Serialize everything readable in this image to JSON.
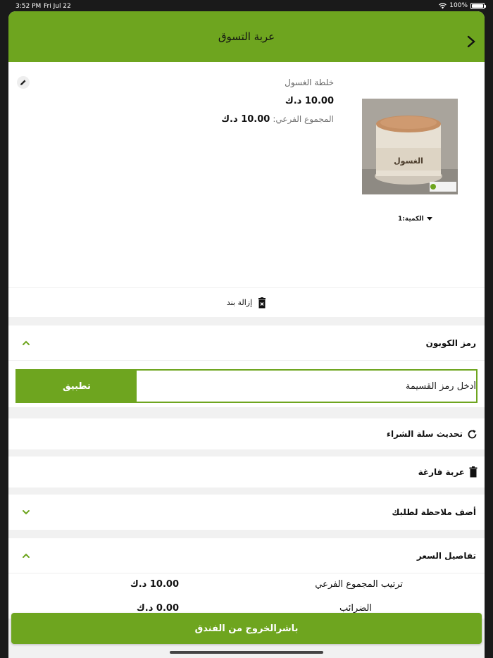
{
  "status_bar": {
    "time": "3:52 PM",
    "date": "Fri Jul 22",
    "battery": "100%"
  },
  "header": {
    "title": "عربة التسوق"
  },
  "product": {
    "name": "خلطة الغسول",
    "price": "10.00 د.ك",
    "subtotal_label": "المجموع الفرعي:",
    "subtotal_value": "10.00 د.ك",
    "quantity_label": "الكمية:1",
    "image_label": "الغسول"
  },
  "remove_item": {
    "label": "إزالة بند"
  },
  "coupon": {
    "title": "رمز الكوبون",
    "input_placeholder": "أدخل رمز القسيمة",
    "apply_label": "تطبيق"
  },
  "update_cart": {
    "label": "تحديث سلة الشراء"
  },
  "empty_cart": {
    "label": "عربة فارغة"
  },
  "add_note": {
    "label": "أضف ملاحظة لطلبك"
  },
  "price_details": {
    "title": "تفاصيل السعر",
    "lines": [
      {
        "label": "ترتيب المجموع الفرعي",
        "value": "10.00 د.ك"
      },
      {
        "label": "الضرائب",
        "value": "0.00 د.ك"
      }
    ]
  },
  "checkout": {
    "label": "باشرالخروج من الفندق"
  },
  "colors": {
    "brand_green": "#6ea51f"
  }
}
